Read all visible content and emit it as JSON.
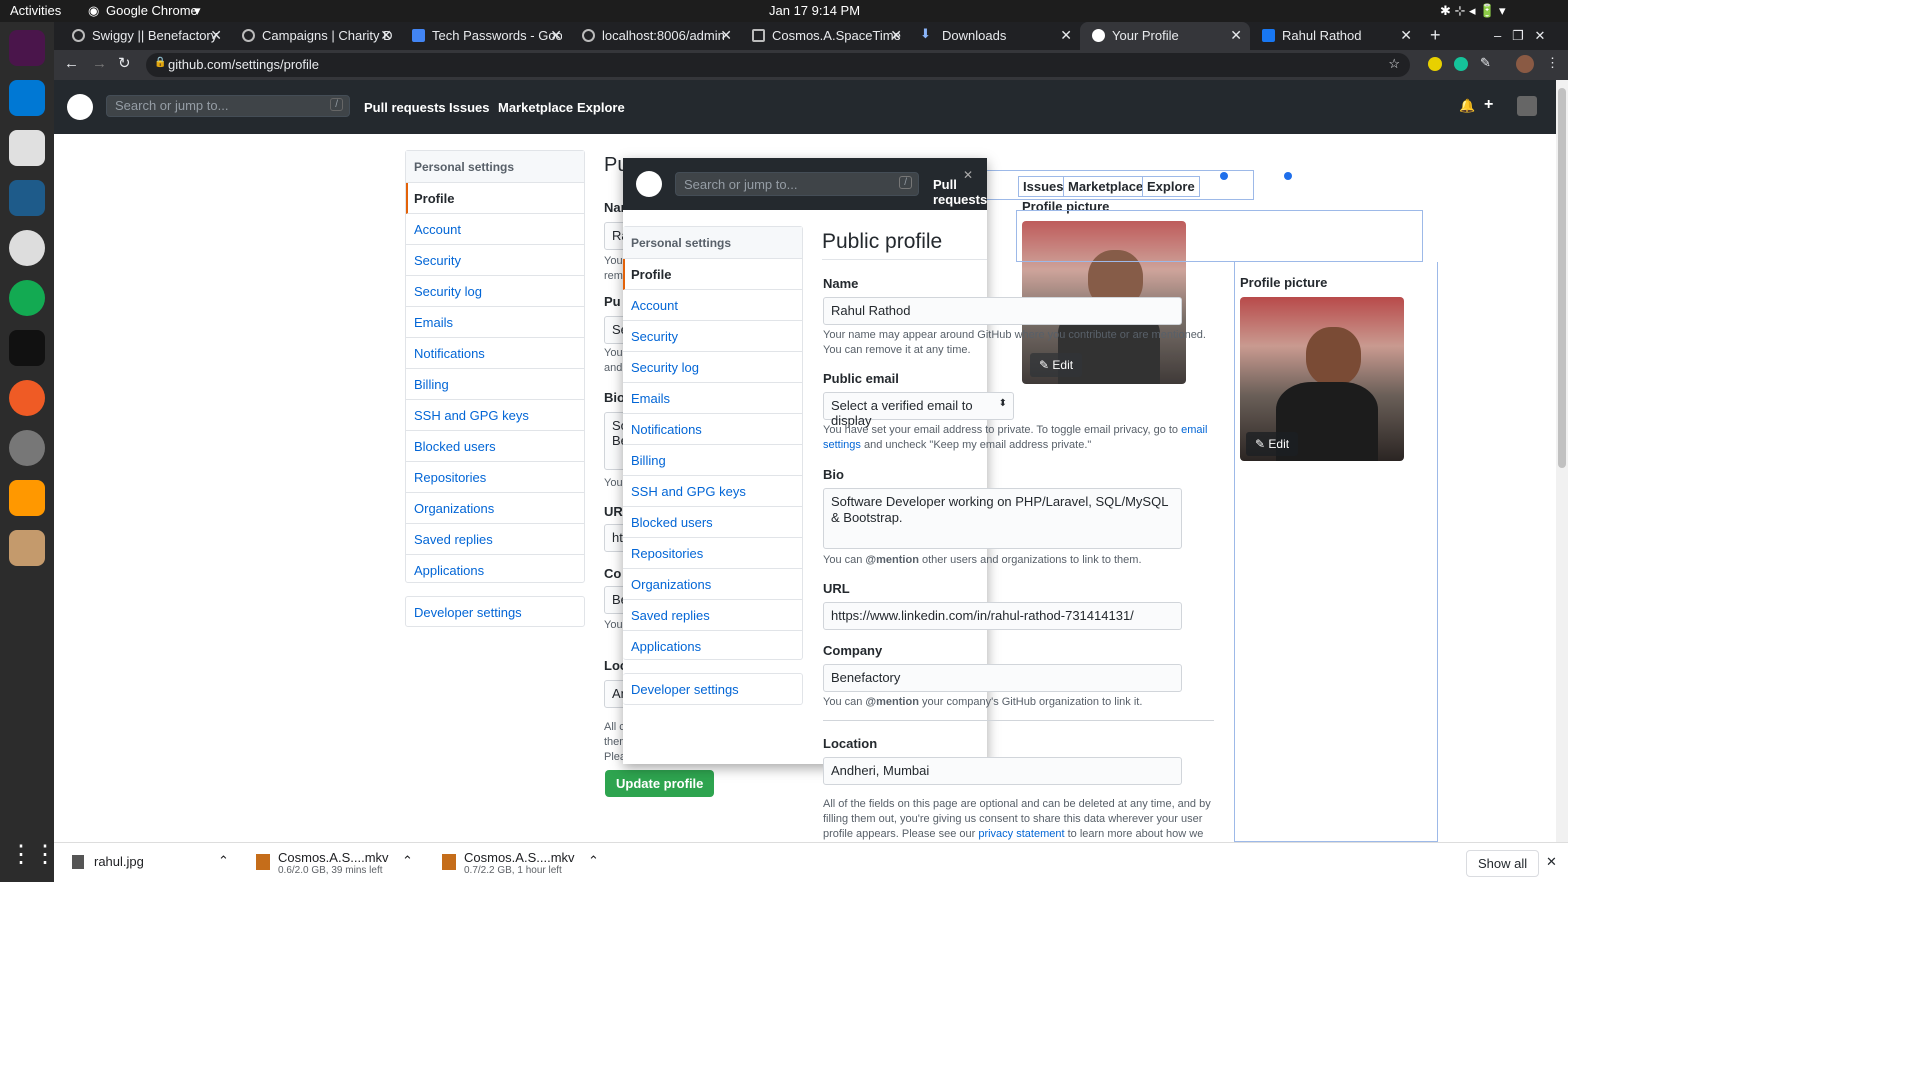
{
  "system_bar": {
    "activities": "Activities",
    "app": "Google Chrome",
    "datetime": "Jan 17  9:14 PM"
  },
  "browser": {
    "tabs": [
      {
        "label": "Swiggy || Benefactory",
        "icon": "globe-icon"
      },
      {
        "label": "Campaigns | Charity D",
        "icon": "globe-icon"
      },
      {
        "label": "Tech Passwords - Goo",
        "icon": "docs-icon"
      },
      {
        "label": "localhost:8006/admin",
        "icon": "globe-icon"
      },
      {
        "label": "Cosmos.A.SpaceTime",
        "icon": "page-icon"
      },
      {
        "label": "Downloads",
        "icon": "download-icon"
      },
      {
        "label": "Your Profile",
        "icon": "github-icon"
      },
      {
        "label": "Rahul Rathod",
        "icon": "facebook-icon"
      }
    ],
    "url": "github.com/settings/profile"
  },
  "github": {
    "search_placeholder": "Search or jump to...",
    "slash": "/",
    "nav": [
      "Pull requests",
      "Issues",
      "Marketplace",
      "Explore"
    ],
    "plus": "+"
  },
  "settings_menu": {
    "heading": "Personal settings",
    "items": [
      "Profile",
      "Account",
      "Security",
      "Security log",
      "Emails",
      "Notifications",
      "Billing",
      "SSH and GPG keys",
      "Blocked users",
      "Repositories",
      "Organizations",
      "Saved replies",
      "Applications"
    ],
    "developer": "Developer settings"
  },
  "profile": {
    "title": "Public profile",
    "name_label": "Name",
    "name_value": "Rahul Rathod",
    "name_note": "Your name may appear around GitHub where you contribute or are mentioned. You can remove it at any time.",
    "email_label": "Public email",
    "email_select": "Select a verified email to display",
    "email_note_1": "You have set your email address to private. To toggle email privacy, go to",
    "email_note_link": "email settings",
    "email_note_2": "and uncheck \"Keep my email address private.\"",
    "bio_label": "Bio",
    "bio_value": "Software Developer working on PHP/Laravel, SQL/MySQL & Bootstrap.",
    "bio_note_1": "You can",
    "bio_note_mention": "@mention",
    "bio_note_2": "other users and organizations to link to them.",
    "url_label": "URL",
    "url_value": "https://www.linkedin.com/in/rahul-rathod-731414131/",
    "company_label": "Company",
    "company_value": "Benefactory",
    "company_note_1": "You can",
    "company_note_mention": "@mention",
    "company_note_2": "your company's GitHub organization to link it.",
    "location_label": "Location",
    "location_value": "Andheri, Mumbai",
    "footer_note_1": "All of the fields on this page are optional and can be deleted at any time, and by filling them out, you're giving us consent to share this data wherever your user profile appears. Please see our",
    "footer_link": "privacy statement",
    "footer_note_2": "to learn more about how we use this information.",
    "picture_label": "Profile picture",
    "edit_label": "Edit",
    "update_button": "Update profile"
  },
  "background_fragments": {
    "title": "Pu",
    "labels": [
      "Nam",
      "Pu",
      "Bio",
      "UR",
      "Co",
      "Loc"
    ],
    "inputs": [
      "Ra",
      "Se",
      "So\nBe",
      "ht",
      "Be",
      "An"
    ],
    "notes": [
      "You\nrem",
      "You\nand",
      "You",
      "You",
      "All c\nthem\nPlea"
    ]
  },
  "downloads": {
    "items": [
      {
        "name": "rahul.jpg",
        "status": ""
      },
      {
        "name": "Cosmos.A.S....mkv",
        "status": "0.6/2.0 GB, 39 mins left"
      },
      {
        "name": "Cosmos.A.S....mkv",
        "status": "0.7/2.2 GB, 1 hour left"
      }
    ],
    "show_all": "Show all"
  }
}
